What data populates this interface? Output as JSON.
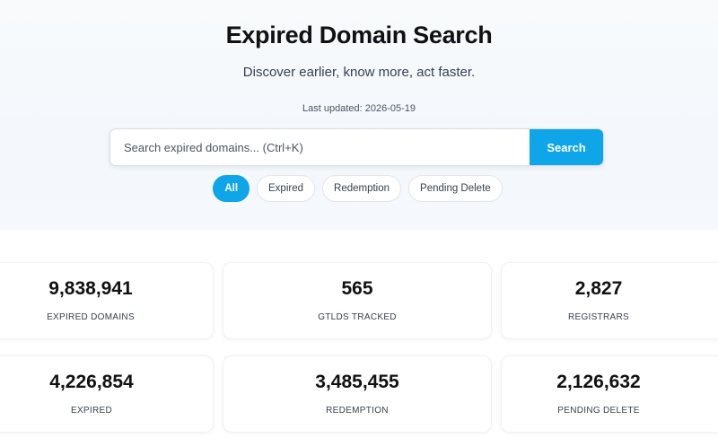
{
  "hero": {
    "title": "Expired Domain Search",
    "subtitle": "Discover earlier, know more, act faster.",
    "last_updated": "Last updated: 2026-05-19"
  },
  "search": {
    "placeholder": "Search expired domains... (Ctrl+K)",
    "button_label": "Search"
  },
  "filters": [
    {
      "label": "All",
      "active": true
    },
    {
      "label": "Expired",
      "active": false
    },
    {
      "label": "Redemption",
      "active": false
    },
    {
      "label": "Pending Delete",
      "active": false
    }
  ],
  "stats": [
    {
      "value": "9,838,941",
      "label": "EXPIRED DOMAINS"
    },
    {
      "value": "565",
      "label": "GTLDS TRACKED"
    },
    {
      "value": "2,827",
      "label": "REGISTRARS"
    },
    {
      "value": "4,226,854",
      "label": "EXPIRED"
    },
    {
      "value": "3,485,455",
      "label": "REDEMPTION"
    },
    {
      "value": "2,126,632",
      "label": "PENDING DELETE"
    }
  ],
  "colors": {
    "accent": "#0ea5e9",
    "text": "#111111"
  }
}
